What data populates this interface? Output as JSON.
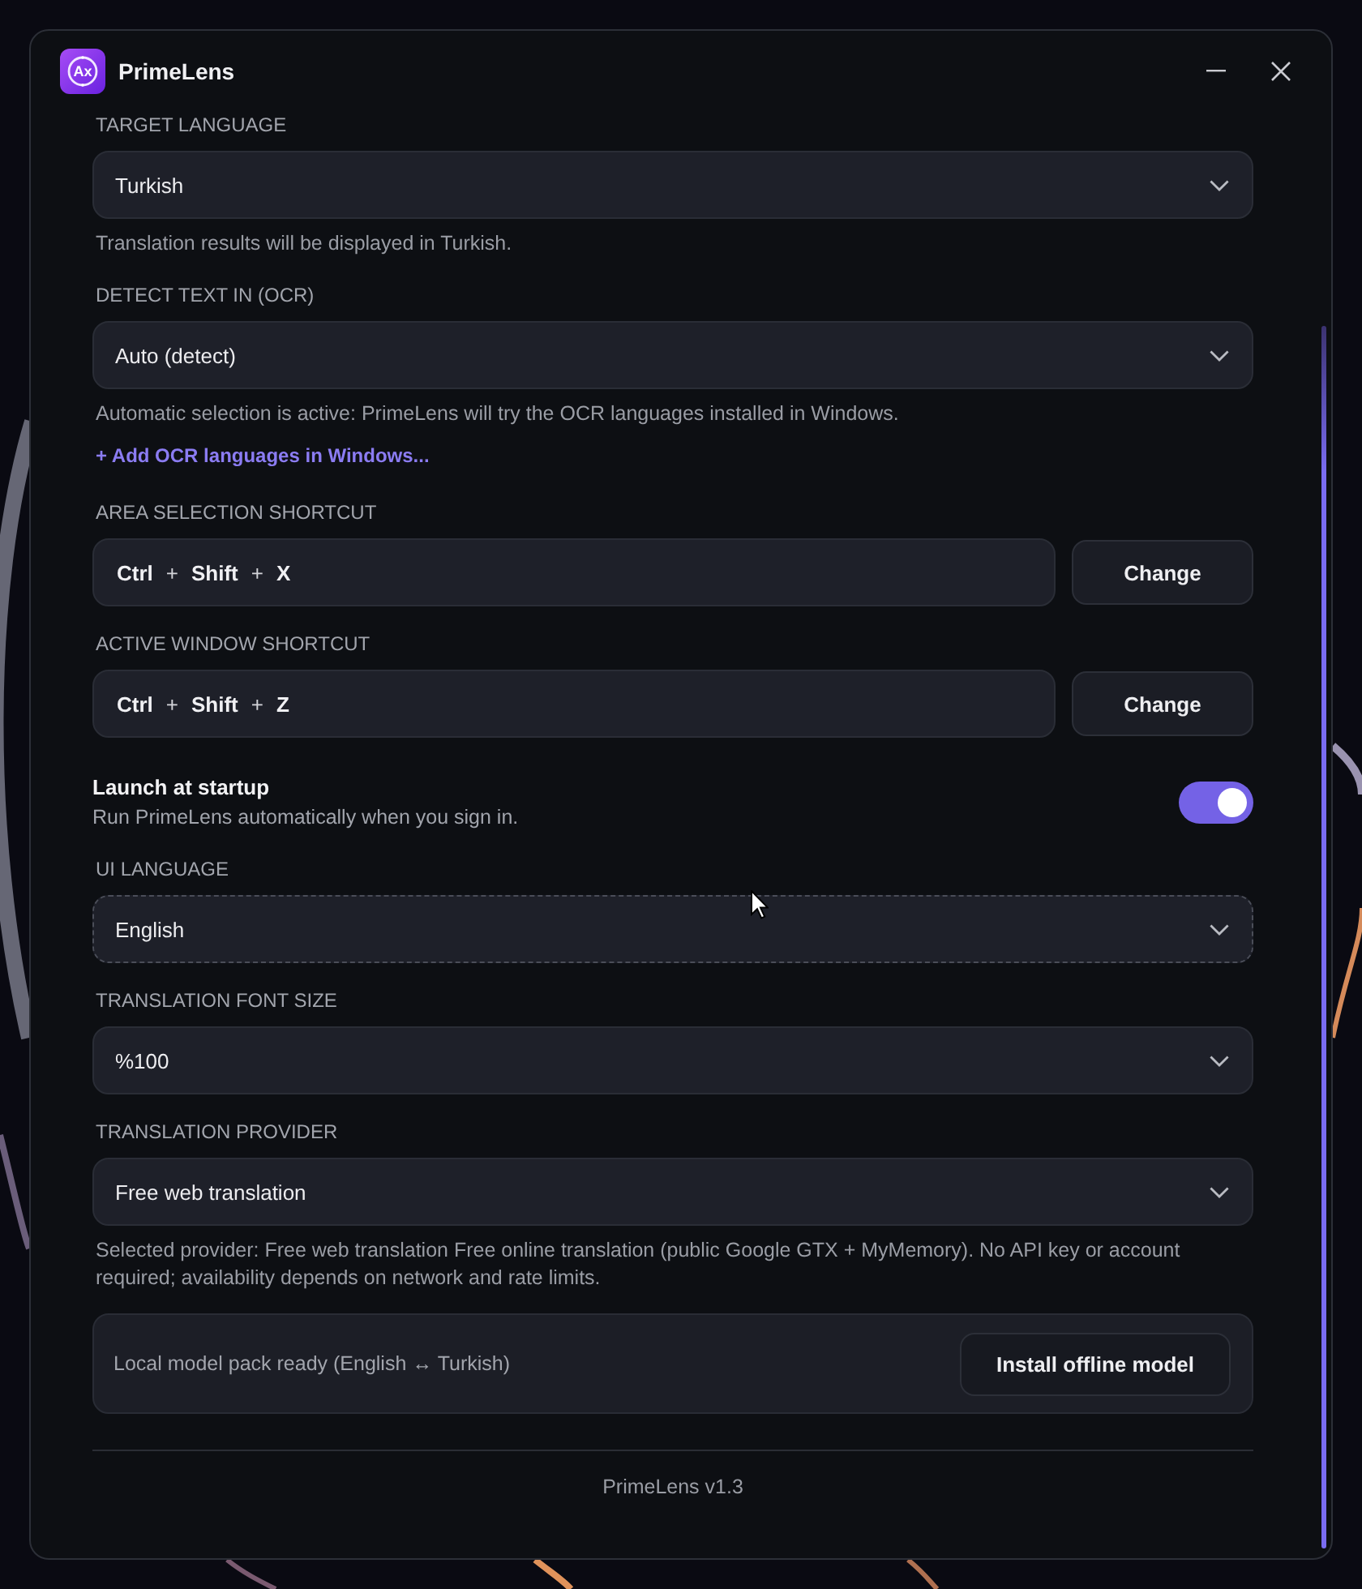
{
  "window": {
    "title": "PrimeLens",
    "logo_text": "Ax"
  },
  "settings": [
    {
      "kind": "select",
      "label": "TARGET LANGUAGE",
      "value": "Turkish",
      "focused": false,
      "help": "Translation results will be displayed in Turkish."
    },
    {
      "kind": "select",
      "label": "DETECT TEXT IN (OCR)",
      "value": "Auto (detect)",
      "focused": false,
      "help": "Automatic selection is active: PrimeLens will try the OCR languages installed in Windows.",
      "link": "+ Add OCR languages in Windows..."
    },
    {
      "kind": "shortcut",
      "label": "AREA SELECTION SHORTCUT",
      "keys": [
        {
          "text": "Ctrl",
          "kind": "key"
        },
        {
          "text": "+",
          "kind": "plus"
        },
        {
          "text": "Shift",
          "kind": "key"
        },
        {
          "text": "+",
          "kind": "plus"
        },
        {
          "text": "X",
          "kind": "key"
        }
      ],
      "button": "Change"
    },
    {
      "kind": "shortcut",
      "label": "ACTIVE WINDOW SHORTCUT",
      "keys": [
        {
          "text": "Ctrl",
          "kind": "key"
        },
        {
          "text": "+",
          "kind": "plus"
        },
        {
          "text": "Shift",
          "kind": "key"
        },
        {
          "text": "+",
          "kind": "plus"
        },
        {
          "text": "Z",
          "kind": "key"
        }
      ],
      "button": "Change"
    },
    {
      "kind": "toggle",
      "title": "Launch at startup",
      "description": "Run PrimeLens automatically when you sign in.",
      "on": true
    },
    {
      "kind": "select",
      "label": "UI LANGUAGE",
      "value": "English",
      "focused": true
    },
    {
      "kind": "select",
      "label": "TRANSLATION FONT SIZE",
      "value": "%100",
      "focused": false
    },
    {
      "kind": "select",
      "label": "TRANSLATION PROVIDER",
      "value": "Free web translation",
      "focused": false,
      "help": "Selected provider: Free web translation Free online translation (public Google GTX + MyMemory). No API key or account required; availability depends on network and rate limits."
    },
    {
      "kind": "model_card",
      "text": "Local model pack ready (English ↔ Turkish)",
      "button": "Install offline model"
    }
  ],
  "footer": {
    "version": "PrimeLens v1.3"
  }
}
